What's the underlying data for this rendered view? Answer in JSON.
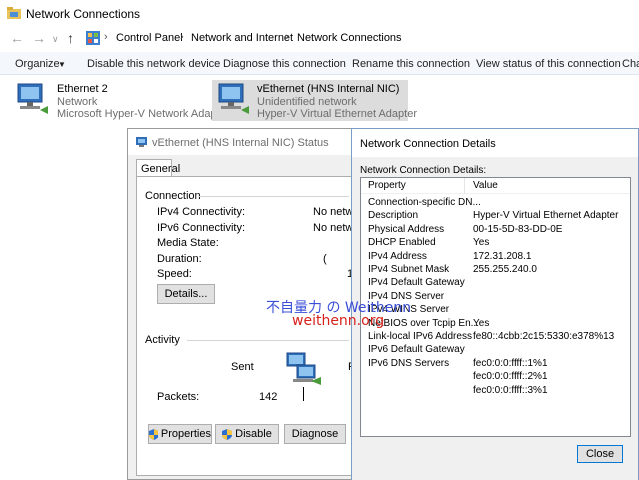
{
  "window": {
    "title": "Network Connections"
  },
  "address": {
    "crumbs": [
      "Control Panel",
      "Network and Internet",
      "Network Connections"
    ]
  },
  "toolbar": {
    "items": [
      "Organize",
      "Disable this network device",
      "Diagnose this connection",
      "Rename this connection",
      "View status of this connection",
      "Cha"
    ]
  },
  "adapters": [
    {
      "name": "Ethernet 2",
      "status": "Network",
      "device": "Microsoft Hyper-V Network Adap..."
    },
    {
      "name": "vEthernet (HNS Internal NIC)",
      "status": "Unidentified network",
      "device": "Hyper-V Virtual Ethernet Adapter"
    }
  ],
  "status_dialog": {
    "title": "vEthernet (HNS Internal NIC) Status",
    "tab": "General",
    "connection_label": "Connection",
    "rows": [
      {
        "k": "IPv4 Connectivity:",
        "v": "No netwo"
      },
      {
        "k": "IPv6 Connectivity:",
        "v": "No netwo"
      },
      {
        "k": "Media State:",
        "v": ""
      },
      {
        "k": "Duration:",
        "v": "("
      },
      {
        "k": "Speed:",
        "v": "1"
      }
    ],
    "details_button": "Details...",
    "activity_label": "Activity",
    "sent_label": "Sent",
    "received_label": "R",
    "packets_label": "Packets:",
    "packets_sent": "142",
    "buttons": {
      "properties": "Properties",
      "disable": "Disable",
      "diagnose": "Diagnose"
    }
  },
  "details_dialog": {
    "title": "Network Connection Details",
    "subtitle": "Network Connection Details:",
    "columns": [
      "Property",
      "Value"
    ],
    "rows": [
      {
        "p": "Connection-specific DN...",
        "v": ""
      },
      {
        "p": "Description",
        "v": "Hyper-V Virtual Ethernet Adapter"
      },
      {
        "p": "Physical Address",
        "v": "00-15-5D-83-DD-0E"
      },
      {
        "p": "DHCP Enabled",
        "v": "Yes"
      },
      {
        "p": "IPv4 Address",
        "v": "172.31.208.1"
      },
      {
        "p": "IPv4 Subnet Mask",
        "v": "255.255.240.0"
      },
      {
        "p": "IPv4 Default Gateway",
        "v": ""
      },
      {
        "p": "IPv4 DNS Server",
        "v": ""
      },
      {
        "p": "IPv4 WINS Server",
        "v": ""
      },
      {
        "p": "NetBIOS over Tcpip En...",
        "v": "Yes"
      },
      {
        "p": "Link-local IPv6 Address",
        "v": "fe80::4cbb:2c15:5330:e378%13"
      },
      {
        "p": "IPv6 Default Gateway",
        "v": ""
      },
      {
        "p": "IPv6 DNS Servers",
        "v": "fec0:0:0:ffff::1%1"
      },
      {
        "p": "",
        "v": "fec0:0:0:ffff::2%1"
      },
      {
        "p": "",
        "v": "fec0:0:0:ffff::3%1"
      }
    ],
    "close_button": "Close"
  },
  "watermark": {
    "line1": "不自量力 の Weithenn",
    "line2": "weithenn.org"
  },
  "colors": {
    "accent": "#0078d7",
    "selection": "#dcdcdc",
    "toolbar_bg": "#f4f7fc"
  }
}
